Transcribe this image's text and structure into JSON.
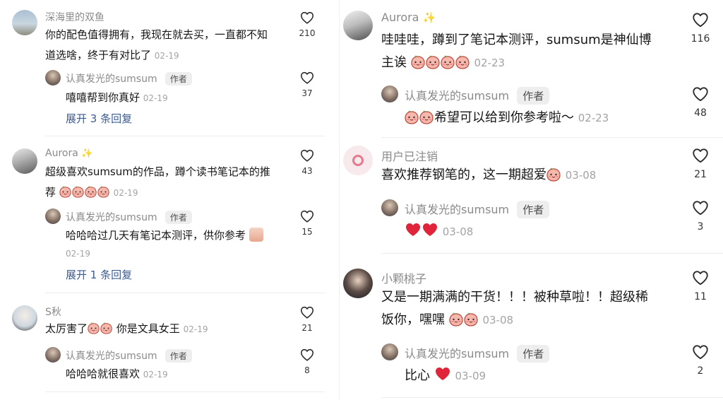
{
  "left": {
    "comments": [
      {
        "name": "深海里的双鱼",
        "line1": "你的配色值得拥有，我现在就去买，一直都不知",
        "line2": "道选啥，终于有对比了",
        "date": "02-19",
        "likes": "210",
        "reply": {
          "name": "认真发光的sumsum",
          "badge": "作者",
          "text": "嘻嘻帮到你真好",
          "date": "02-19",
          "likes": "37"
        },
        "expand": "展开 3 条回复"
      },
      {
        "name": "Aurora",
        "line1": "超级喜欢sumsum的作品，蹲个读书笔记本的推",
        "line2": "荐",
        "date": "02-19",
        "likes": "43",
        "reply": {
          "name": "认真发光的sumsum",
          "badge": "作者",
          "text": "哈哈哈过几天有笔记本测评，供你参考",
          "date": "02-19",
          "likes": "15"
        },
        "expand": "展开 1 条回复"
      },
      {
        "name": "S秋",
        "text_a": "太厉害了",
        "text_b": "你是文具女王",
        "date": "02-19",
        "likes": "21",
        "reply": {
          "name": "认真发光的sumsum",
          "badge": "作者",
          "text": "哈哈哈就很喜欢",
          "date": "02-19",
          "likes": "8"
        }
      }
    ]
  },
  "right": {
    "comments": [
      {
        "name": "Aurora",
        "line1": "哇哇哇，蹲到了笔记本测评，sumsum是神仙博",
        "line2": "主诶",
        "date": "02-23",
        "likes": "116",
        "reply": {
          "name": "认真发光的sumsum",
          "badge": "作者",
          "text": "希望可以给到你参考啦～",
          "date": "02-23",
          "likes": "48"
        }
      },
      {
        "name": "用户已注销",
        "text": "喜欢推荐钢笔的，这一期超爱",
        "date": "03-08",
        "likes": "21",
        "reply": {
          "name": "认真发光的sumsum",
          "badge": "作者",
          "date": "03-08",
          "likes": "3"
        }
      },
      {
        "name": "小颗桃子",
        "line1": "又是一期满满的干货！！！被种草啦！！超级稀",
        "line2": "饭你，嘿嘿",
        "date": "03-08",
        "likes": "11",
        "reply": {
          "name": "认真发光的sumsum",
          "badge": "作者",
          "text": "比心",
          "date": "03-09",
          "likes": "2"
        }
      }
    ]
  },
  "colors": {
    "text": "#161616",
    "meta": "#8a8a8a",
    "link": "#3b5b91",
    "badge_bg": "#eeeeee",
    "heart": "#e0243a"
  },
  "icons": {
    "like": "heart-outline-icon",
    "emoji": "peach-face-emoji",
    "heart": "red-heart-emoji",
    "sparkle": "sparkles-emoji"
  }
}
